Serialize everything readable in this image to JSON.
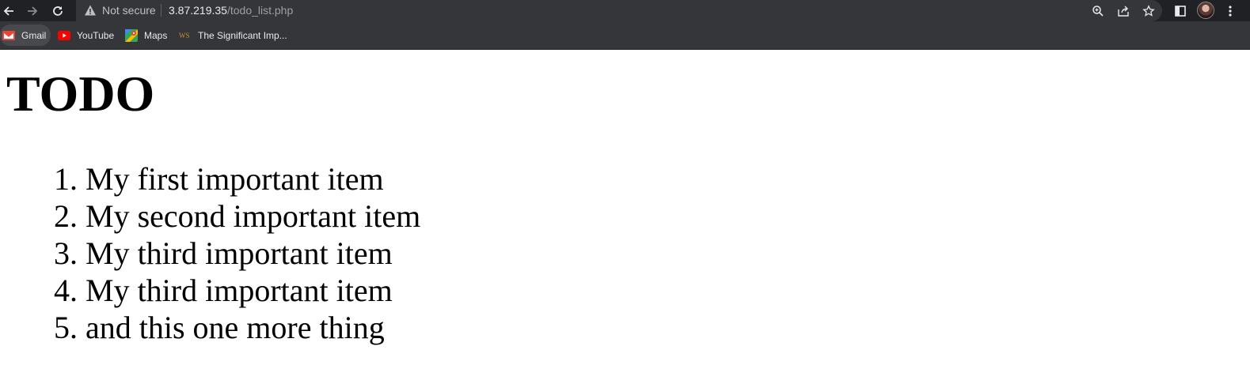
{
  "browser": {
    "omnibox": {
      "security_label": "Not secure",
      "url_host": "3.87.219.35",
      "url_path": "/todo_list.php"
    },
    "bookmarks": [
      {
        "label": "Gmail",
        "icon": "gmail-icon"
      },
      {
        "label": "YouTube",
        "icon": "youtube-icon"
      },
      {
        "label": "Maps",
        "icon": "maps-icon"
      },
      {
        "label": "The Significant Imp...",
        "icon": "ws-icon"
      }
    ]
  },
  "page": {
    "title": "TODO",
    "items": [
      {
        "num": "1.",
        "text": "My first important item"
      },
      {
        "num": "2.",
        "text": "My second important item"
      },
      {
        "num": "3.",
        "text": "My third important item"
      },
      {
        "num": "4.",
        "text": "My third important item"
      },
      {
        "num": "5.",
        "text": "and this one more thing"
      }
    ]
  },
  "colors": {
    "toolbar_bg": "#202124",
    "bar_bg": "#35363a",
    "page_bg": "#ffffff",
    "text": "#000000"
  }
}
